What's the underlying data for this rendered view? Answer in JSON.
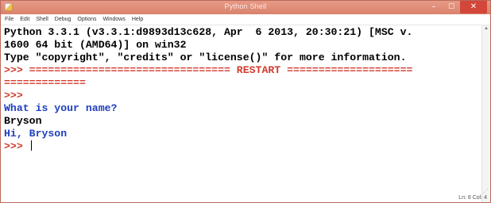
{
  "window": {
    "title": "Python Shell",
    "minimize_glyph": "–",
    "maximize_glyph": "☐",
    "close_glyph": "✕"
  },
  "menu": {
    "items": [
      "File",
      "Edit",
      "Shell",
      "Debug",
      "Options",
      "Windows",
      "Help"
    ]
  },
  "shell": {
    "lines": [
      {
        "text": "Python 3.3.1 (v3.3.1:d9893d13c628, Apr  6 2013, 20:30:21) [MSC v.",
        "color": "black"
      },
      {
        "text": "1600 64 bit (AMD64)] on win32",
        "color": "black"
      },
      {
        "text": "Type \"copyright\", \"credits\" or \"license()\" for more information.",
        "color": "black"
      },
      {
        "text": ">>> ================================ RESTART ====================",
        "color": "red"
      },
      {
        "text": "=============",
        "color": "red"
      },
      {
        "text": ">>>",
        "color": "red"
      },
      {
        "text": "What is your name?",
        "color": "blue"
      },
      {
        "text": "Bryson",
        "color": "black"
      },
      {
        "text": "Hi, Bryson",
        "color": "blue"
      },
      {
        "text": ">>> ",
        "color": "red",
        "cursor": true
      }
    ]
  },
  "status": {
    "position": "Ln: 8 Col: 4"
  },
  "colors": {
    "titlebar": "#d9826d",
    "prompt_red": "#d23b2e",
    "output_blue": "#1f3fbf",
    "text_black": "#000000"
  }
}
